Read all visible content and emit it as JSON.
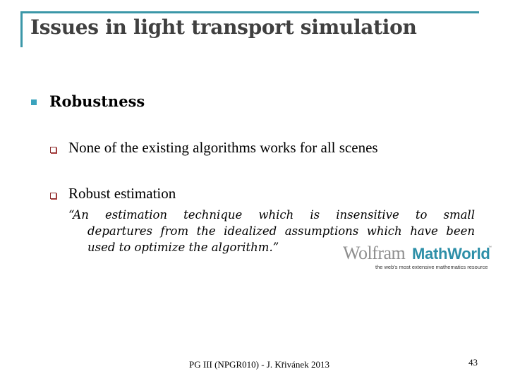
{
  "slide": {
    "title": "Issues in light transport simulation",
    "accent_color": "#3b97a8",
    "bullets": [
      {
        "text": "Robustness",
        "children": [
          {
            "text": "None of the existing algorithms works for all scenes"
          },
          {
            "text": "Robust estimation"
          }
        ]
      }
    ],
    "quote": {
      "line1": "“An estimation technique which is insensitive to small",
      "line2": "departures from the idealized assumptions which have been",
      "line3": "used to optimize the algorithm.”"
    },
    "logo": {
      "brand_primary": "Wolfram",
      "brand_secondary": "MathWorld",
      "trademark": "™",
      "tagline": "the web's most extensive mathematics resource"
    },
    "footer": "PG III (NPGR010) - J. Křivánek 2013",
    "page_number": "43"
  }
}
